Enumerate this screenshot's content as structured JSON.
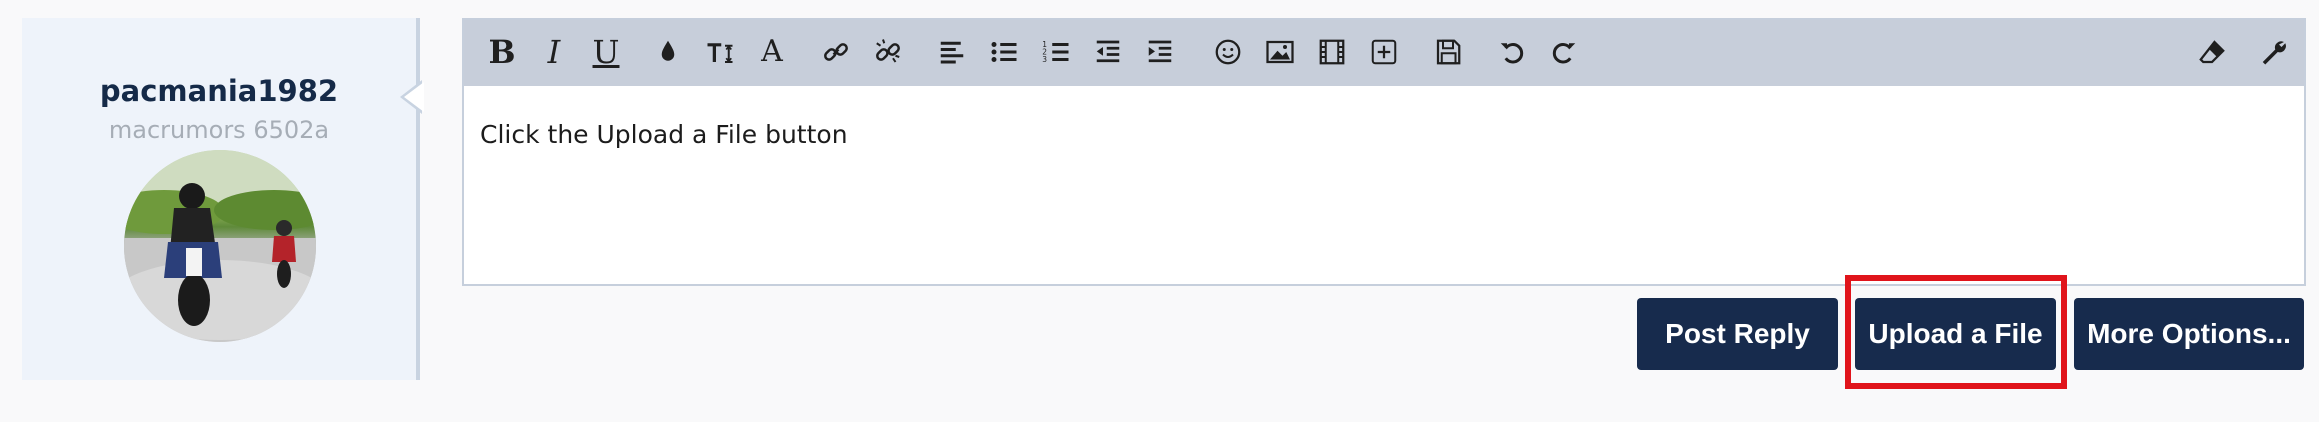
{
  "user": {
    "username": "pacmania1982",
    "title": "macrumors 6502a"
  },
  "editor": {
    "toolbar": [
      {
        "icon": "bold-icon",
        "glyph": "B"
      },
      {
        "icon": "italic-icon",
        "glyph": "I"
      },
      {
        "icon": "underline-icon",
        "glyph": "U"
      },
      {
        "icon": "text-color-icon"
      },
      {
        "icon": "font-size-icon"
      },
      {
        "icon": "font-family-icon",
        "glyph": "A"
      },
      {
        "icon": "link-icon"
      },
      {
        "icon": "unlink-icon"
      },
      {
        "icon": "align-icon"
      },
      {
        "icon": "bullet-list-icon"
      },
      {
        "icon": "numbered-list-icon"
      },
      {
        "icon": "outdent-icon"
      },
      {
        "icon": "indent-icon"
      },
      {
        "icon": "smilie-icon"
      },
      {
        "icon": "image-icon"
      },
      {
        "icon": "media-icon"
      },
      {
        "icon": "insert-icon"
      },
      {
        "icon": "save-draft-icon"
      },
      {
        "icon": "undo-icon"
      },
      {
        "icon": "redo-icon"
      },
      {
        "icon": "remove-formatting-icon"
      },
      {
        "icon": "settings-wrench-icon"
      }
    ],
    "content": "Click the Upload a File button"
  },
  "actions": {
    "post_reply": "Post Reply",
    "upload_file": "Upload a File",
    "more_options": "More Options..."
  },
  "colors": {
    "button_bg": "#172b4d",
    "toolbar_bg": "#c7ceda",
    "panel_bg": "#eef3fa",
    "highlight": "#e0141b",
    "username": "#152a48"
  }
}
